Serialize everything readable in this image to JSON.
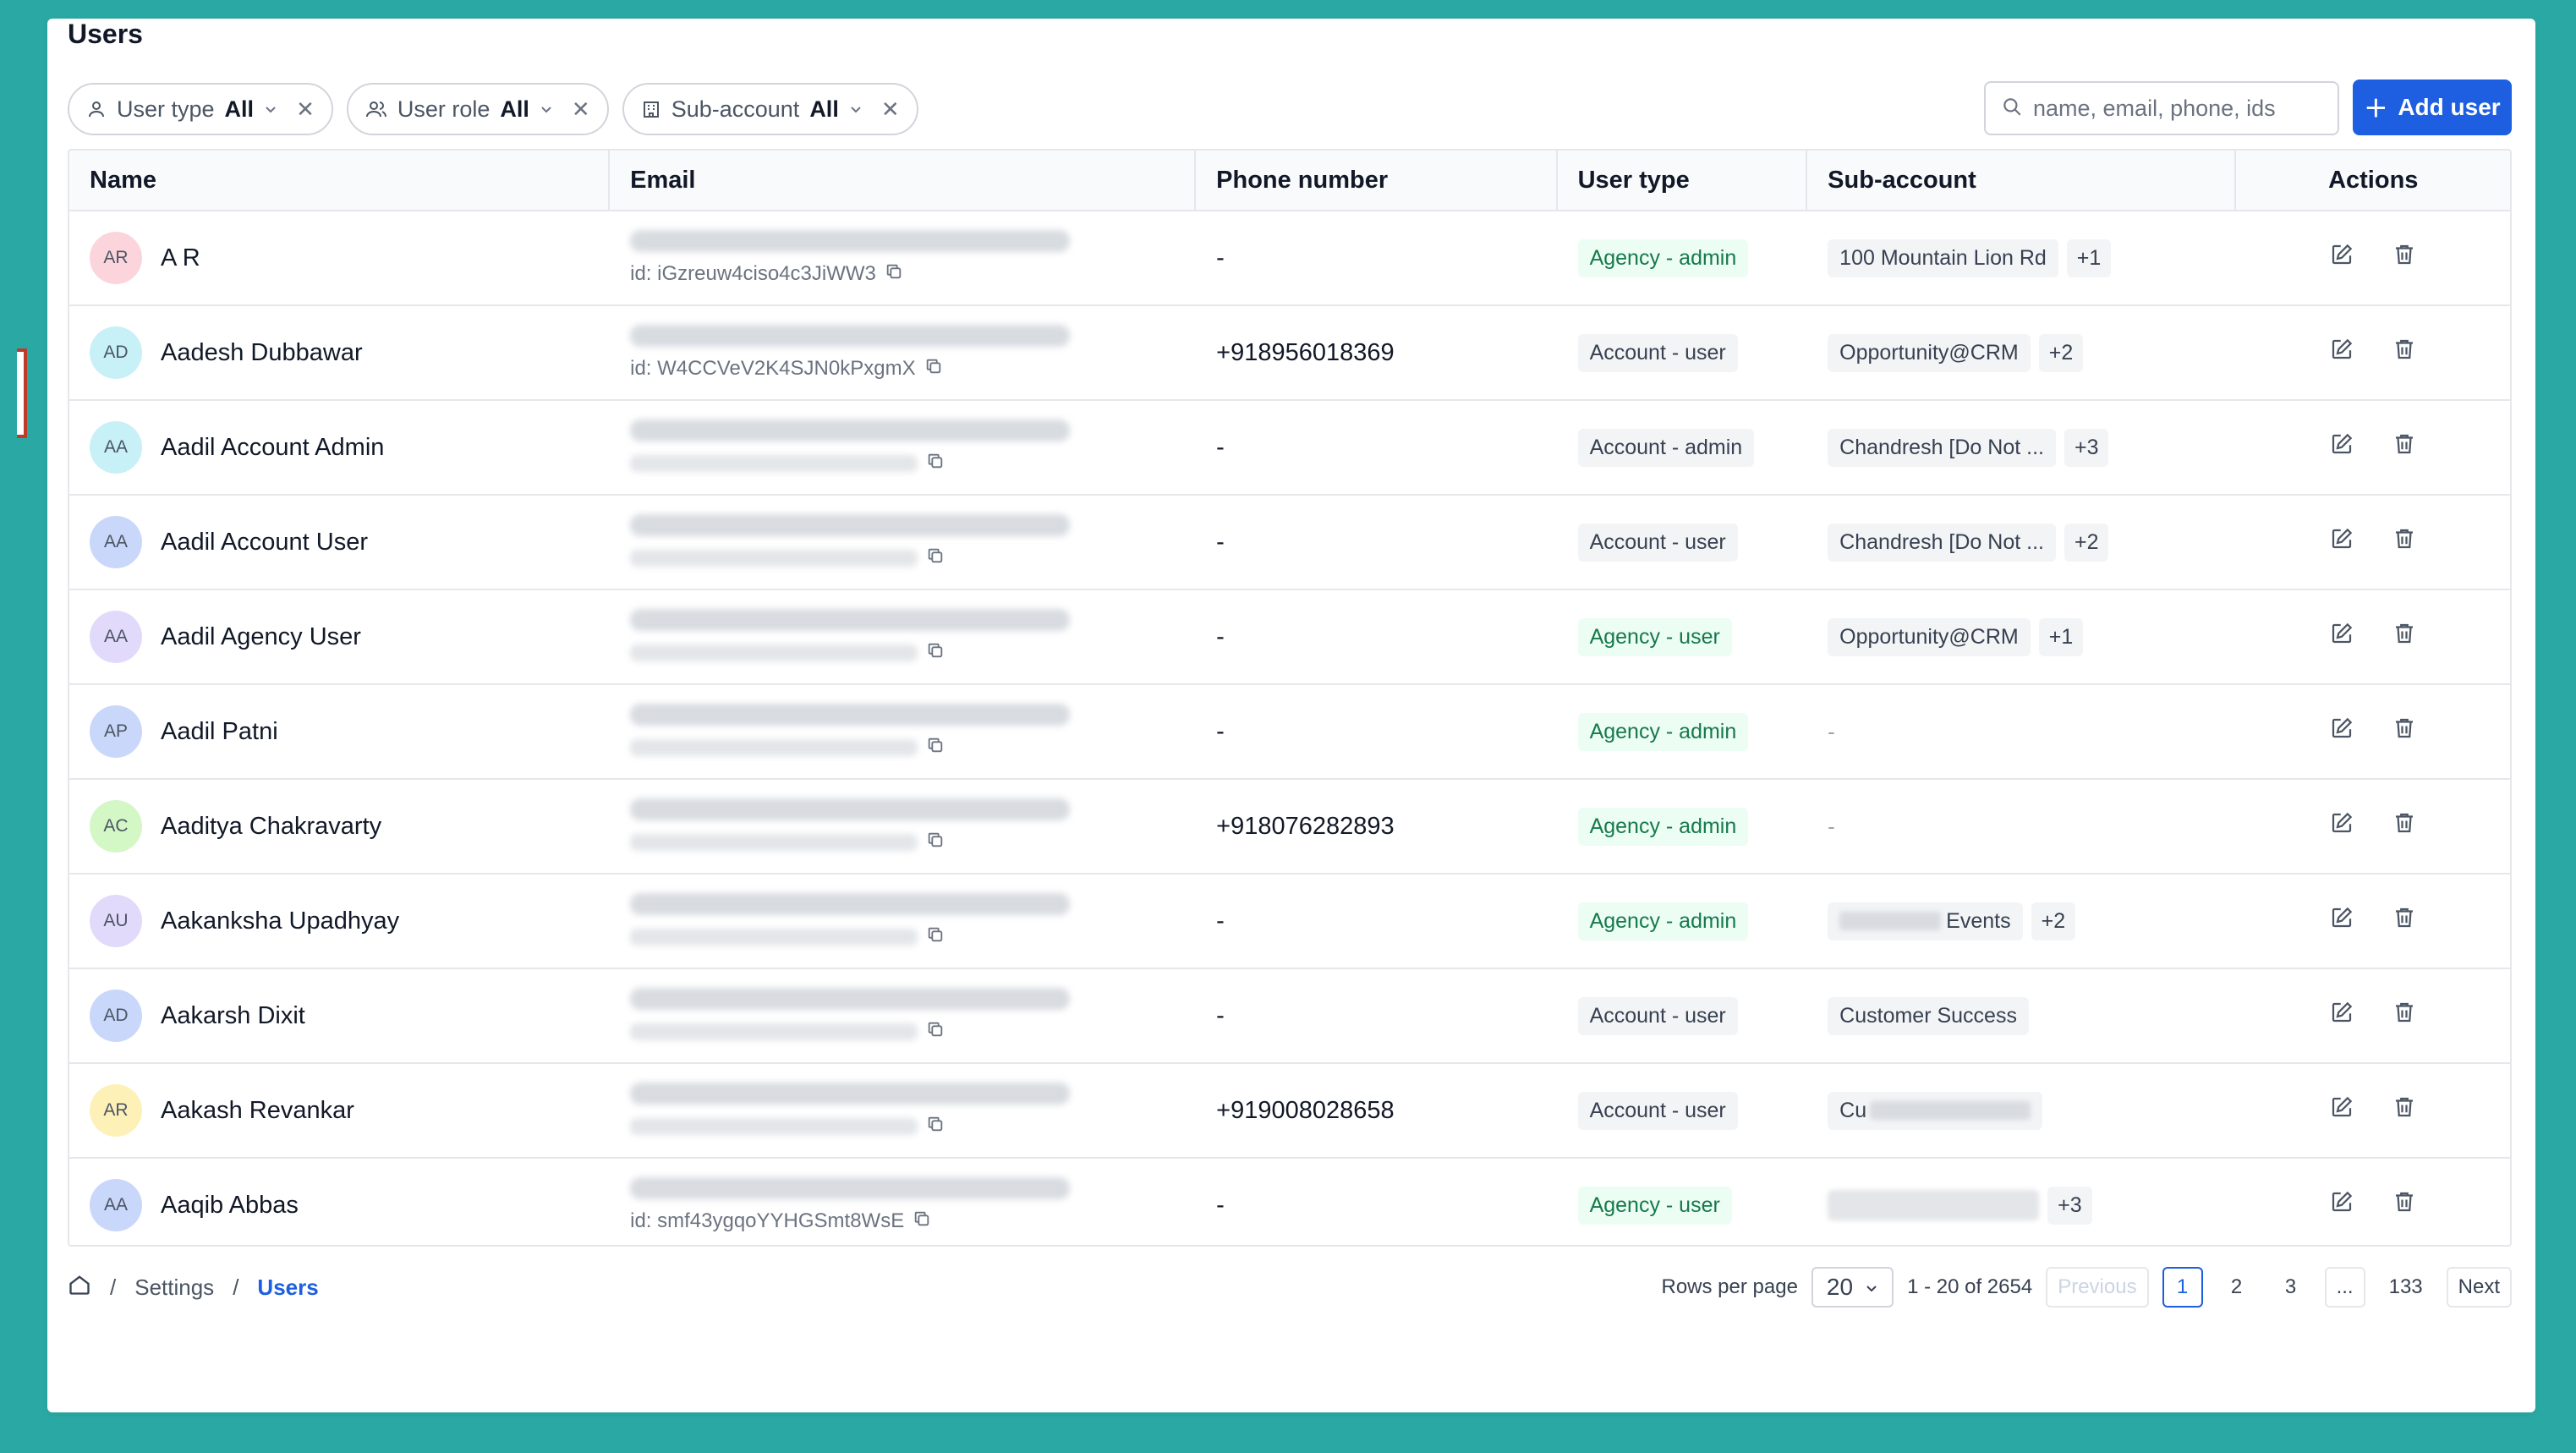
{
  "page": {
    "title": "Users"
  },
  "filters": [
    {
      "icon": "user-icon",
      "label": "User type",
      "value": "All"
    },
    {
      "icon": "users-icon",
      "label": "User role",
      "value": "All"
    },
    {
      "icon": "building-icon",
      "label": "Sub-account",
      "value": "All"
    }
  ],
  "search": {
    "placeholder": "name, email, phone, ids"
  },
  "add_user": {
    "label": "Add user"
  },
  "columns": [
    "Name",
    "Email",
    "Phone number",
    "User type",
    "Sub-account",
    "Actions"
  ],
  "rows": [
    {
      "initials": "AR",
      "avatar_color": "#fcd5dc",
      "name": "A R",
      "id": "id: iGzreuw4ciso4c3JiWW3",
      "phone": "-",
      "type": "Agency - admin",
      "type_kind": "agency",
      "sub": "100 Mountain Lion Rd",
      "more": "+1"
    },
    {
      "initials": "AD",
      "avatar_color": "#c7f0f7",
      "name": "Aadesh Dubbawar",
      "id": "id: W4CCVeV2K4SJN0kPxgmX",
      "phone": "+918956018369",
      "type": "Account - user",
      "type_kind": "account",
      "sub": "Opportunity@CRM",
      "more": "+2"
    },
    {
      "initials": "AA",
      "avatar_color": "#c7f0f7",
      "name": "Aadil Account Admin",
      "id": "",
      "phone": "-",
      "type": "Account - admin",
      "type_kind": "account",
      "sub": "Chandresh [Do Not ...",
      "more": "+3"
    },
    {
      "initials": "AA",
      "avatar_color": "#c9d7fb",
      "name": "Aadil Account User",
      "id": "",
      "phone": "-",
      "type": "Account - user",
      "type_kind": "account",
      "sub": "Chandresh [Do Not ...",
      "more": "+2"
    },
    {
      "initials": "AA",
      "avatar_color": "#e2dafb",
      "name": "Aadil Agency User",
      "id": "",
      "phone": "-",
      "type": "Agency - user",
      "type_kind": "agency",
      "sub": "Opportunity@CRM",
      "more": "+1"
    },
    {
      "initials": "AP",
      "avatar_color": "#c9d7fb",
      "name": "Aadil Patni",
      "id": "",
      "phone": "-",
      "type": "Agency - admin",
      "type_kind": "agency",
      "sub": "-",
      "more": ""
    },
    {
      "initials": "AC",
      "avatar_color": "#d4f7c6",
      "name": "Aaditya Chakravarty",
      "id": "",
      "phone": "+918076282893",
      "type": "Agency - admin",
      "type_kind": "agency",
      "sub": "-",
      "more": ""
    },
    {
      "initials": "AU",
      "avatar_color": "#e2dafb",
      "name": "Aakanksha Upadhyay",
      "id": "",
      "phone": "-",
      "type": "Agency - admin",
      "type_kind": "agency",
      "sub": "Events",
      "more": "+2",
      "sub_blur_prefix": true
    },
    {
      "initials": "AD",
      "avatar_color": "#c9d7fb",
      "name": "Aakarsh Dixit",
      "id": "",
      "phone": "-",
      "type": "Account - user",
      "type_kind": "account",
      "sub": "Customer Success",
      "more": ""
    },
    {
      "initials": "AR",
      "avatar_color": "#fdf1b8",
      "name": "Aakash Revankar",
      "id": "",
      "phone": "+919008028658",
      "type": "Account - user",
      "type_kind": "account",
      "sub": "Cu",
      "more": "",
      "sub_blur_suffix": true
    },
    {
      "initials": "AA",
      "avatar_color": "#c9d7fb",
      "name": "Aaqib Abbas",
      "id": "id: smf43ygqoYYHGSmt8WsE",
      "phone": "-",
      "type": "Agency - user",
      "type_kind": "agency",
      "sub": "",
      "more": "+3",
      "sub_blurred": true
    }
  ],
  "breadcrumb": {
    "items": [
      "Settings",
      "Users"
    ]
  },
  "pagination": {
    "rows_per_page_label": "Rows per page",
    "rows_per_page": "20",
    "range": "1 - 20 of 2654",
    "previous": "Previous",
    "pages": [
      "1",
      "2",
      "3",
      "...",
      "133"
    ],
    "current": "1",
    "next": "Next"
  }
}
